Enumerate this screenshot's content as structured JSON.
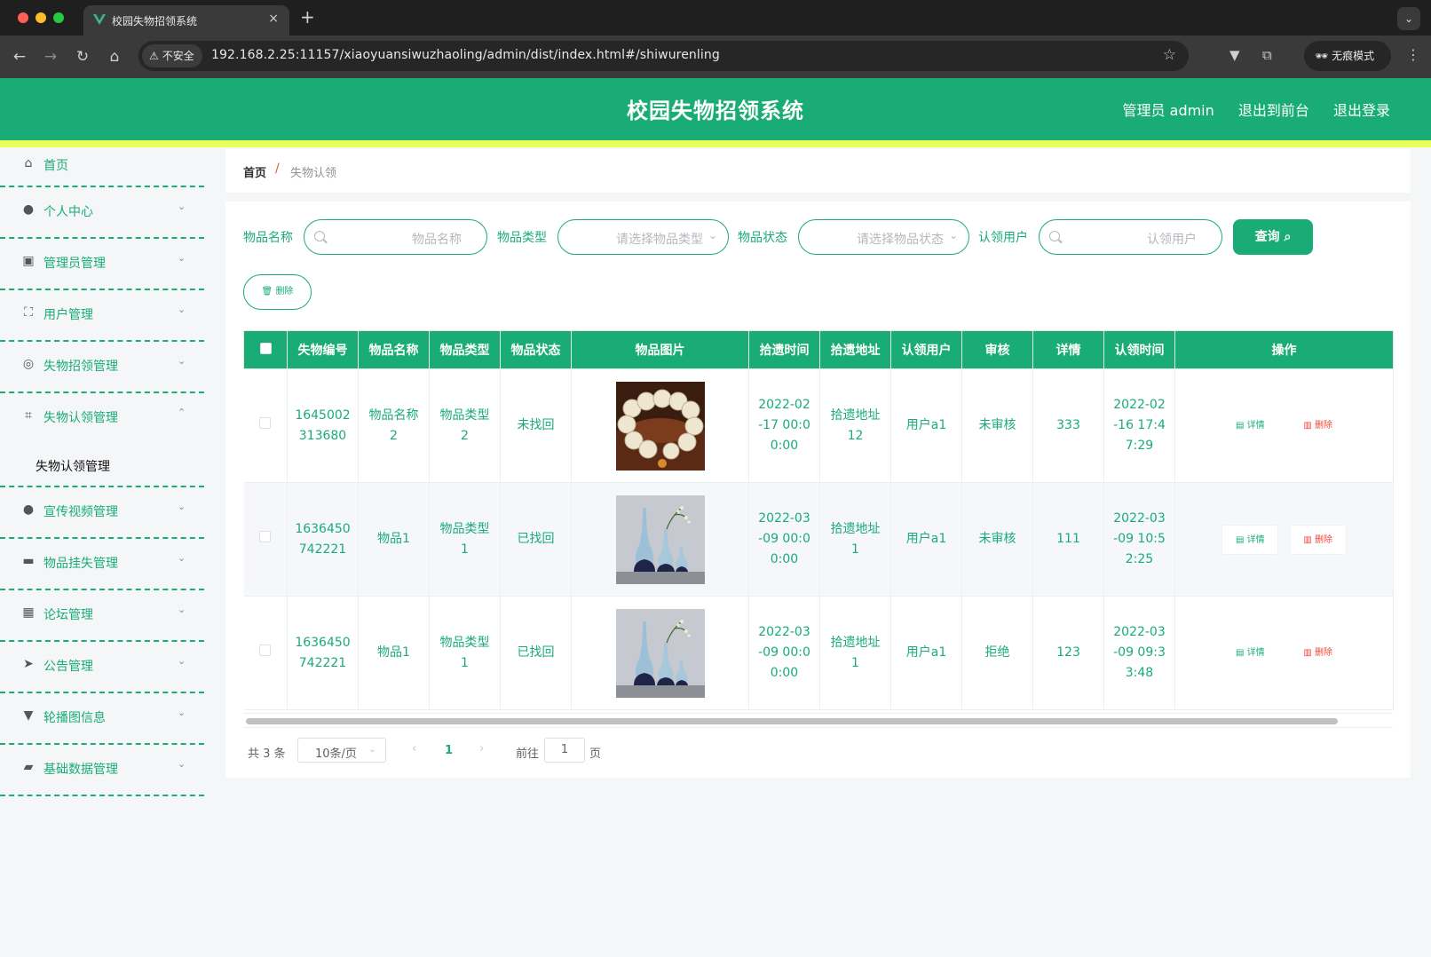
{
  "browser": {
    "tab_title": "校园失物招领系统",
    "tab_close": "×",
    "new_tab": "+",
    "security_label": "不安全",
    "url": "192.168.2.25:11157/xiaoyuansiwuzhaoling/admin/dist/index.html#/shiwurenling",
    "incognito_label": "无痕模式"
  },
  "header": {
    "title": "校园失物招领系统",
    "admin_label": "管理员 admin",
    "back_front": "退出到前台",
    "logout": "退出登录"
  },
  "sidebar": {
    "home": "首页",
    "items": [
      {
        "label": "个人中心",
        "icon": "user-icon"
      },
      {
        "label": "管理员管理",
        "icon": "clipboard-icon"
      },
      {
        "label": "用户管理",
        "icon": "fullscreen-icon"
      },
      {
        "label": "失物招领管理",
        "icon": "compass-icon"
      },
      {
        "label": "失物认领管理",
        "icon": "crop-icon",
        "expanded": true
      }
    ],
    "active_sub": "失物认领管理",
    "items_after": [
      {
        "label": "宣传视频管理",
        "icon": "user-icon"
      },
      {
        "label": "物品挂失管理",
        "icon": "briefcase-icon"
      },
      {
        "label": "论坛管理",
        "icon": "grid-icon"
      },
      {
        "label": "公告管理",
        "icon": "send-icon"
      },
      {
        "label": "轮播图信息",
        "icon": "brush-icon"
      },
      {
        "label": "基础数据管理",
        "icon": "ticket-icon"
      }
    ]
  },
  "breadcrumb": {
    "home": "首页",
    "separator": "/",
    "current": "失物认领"
  },
  "filters": {
    "name_label": "物品名称",
    "name_placeholder": "物品名称",
    "type_label": "物品类型",
    "type_placeholder": "请选择物品类型",
    "status_label": "物品状态",
    "status_placeholder": "请选择物品状态",
    "user_label": "认领用户",
    "user_placeholder": "认领用户",
    "search_button": "查询",
    "delete_button": "删除"
  },
  "table": {
    "columns": [
      "失物编号",
      "物品名称",
      "物品类型",
      "物品状态",
      "物品图片",
      "拾遗时间",
      "拾遗地址",
      "认领用户",
      "审核",
      "详情",
      "认领时间",
      "操作"
    ],
    "rows": [
      {
        "id": "1645002313680",
        "name": "物品名称2",
        "type": "物品类型2",
        "status": "未找回",
        "image": "bead-bracelet",
        "found_time": "2022-02-17 00:00:00",
        "address": "拾遗地址12",
        "user": "用户a1",
        "review": "未审核",
        "detail": "333",
        "claim_time": "2022-02-16 17:47:29"
      },
      {
        "id": "1636450742221",
        "name": "物品1",
        "type": "物品类型1",
        "status": "已找回",
        "image": "vases",
        "found_time": "2022-03-09 00:00:00",
        "address": "拾遗地址1",
        "user": "用户a1",
        "review": "未审核",
        "detail": "111",
        "claim_time": "2022-03-09 10:52:25"
      },
      {
        "id": "1636450742221",
        "name": "物品1",
        "type": "物品类型1",
        "status": "已找回",
        "image": "vases",
        "found_time": "2022-03-09 00:00:00",
        "address": "拾遗地址1",
        "user": "用户a1",
        "review": "拒绝",
        "detail": "123",
        "claim_time": "2022-03-09 09:33:48"
      }
    ],
    "action_detail": "详情",
    "action_delete": "删除"
  },
  "pagination": {
    "total": "共 3 条",
    "page_size": "10条/页",
    "current_page": "1",
    "goto_label": "前往",
    "goto_value": "1",
    "page_unit": "页"
  },
  "colors": {
    "primary": "#19ac76",
    "stripe": "#e9ff5c",
    "danger": "#f0463c"
  }
}
